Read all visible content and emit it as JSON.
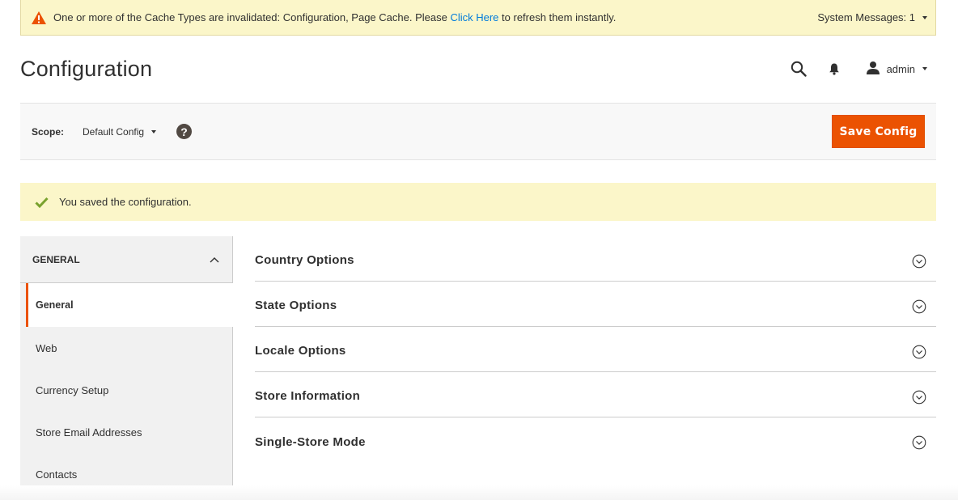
{
  "system_message": {
    "text_before": "One or more of the Cache Types are invalidated: Configuration, Page Cache. Please ",
    "link_text": "Click Here",
    "text_after": " to refresh them instantly.",
    "count_label": "System Messages: 1",
    "icon": "warning-icon"
  },
  "header": {
    "title": "Configuration",
    "user_name": "admin",
    "icons": [
      "search-icon",
      "bell-icon",
      "user-icon"
    ]
  },
  "scope": {
    "label": "Scope:",
    "value": "Default Config",
    "help": "?",
    "save_label": "Save Config"
  },
  "success_message": {
    "text": "You saved the configuration.",
    "icon": "checkmark-icon"
  },
  "sidebar": {
    "group_title": "GENERAL",
    "items": [
      {
        "label": "General",
        "active": true
      },
      {
        "label": "Web",
        "active": false
      },
      {
        "label": "Currency Setup",
        "active": false
      },
      {
        "label": "Store Email Addresses",
        "active": false
      },
      {
        "label": "Contacts",
        "active": false
      }
    ]
  },
  "sections": [
    {
      "title": "Country Options"
    },
    {
      "title": "State Options"
    },
    {
      "title": "Locale Options"
    },
    {
      "title": "Store Information"
    },
    {
      "title": "Single-Store Mode"
    }
  ],
  "colors": {
    "accent": "#eb5202",
    "message_bg": "#fbf6c9",
    "link": "#007bdb",
    "success": "#79a22e",
    "warning": "#eb5202"
  }
}
